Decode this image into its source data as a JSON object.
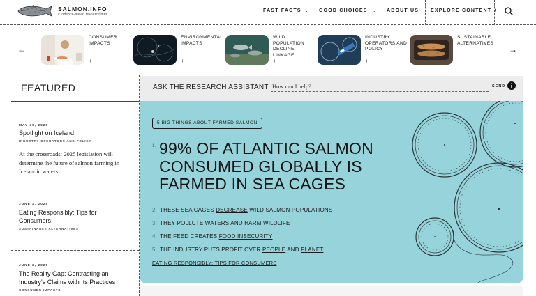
{
  "header": {
    "site_name": "SALMON.INFO",
    "tagline": "Evidence-based resource hub",
    "nav": [
      {
        "label": "FAST FACTS"
      },
      {
        "label": "GOOD CHOICES"
      },
      {
        "label": "ABOUT US"
      },
      {
        "label": "EXPLORE CONTENT +"
      }
    ],
    "icons": {
      "logo": "salmon-fish-logo",
      "search": "search-icon"
    }
  },
  "topics": {
    "prev_arrow": "←",
    "next_arrow": "→",
    "plus": "+",
    "items": [
      {
        "label": "CONSUMER IMPACTS"
      },
      {
        "label": "ENVIRONMENTAL IMPACTS"
      },
      {
        "label": "WILD POPULATION DECLINE LINKAGE"
      },
      {
        "label": "INDUSTRY OPERATORS AND POLICY"
      },
      {
        "label": "SUSTAINABLE ALTERNATIVES"
      }
    ]
  },
  "featured": {
    "title": "FEATURED",
    "items": [
      {
        "date": "MAY 30, 2025",
        "title": "Spotlight on Iceland",
        "category": "INDUSTRY OPERATORS AND POLICY",
        "excerpt": "At the crossroads: 2025 legislation will determine the future of salmon farming in Icelandic waters"
      },
      {
        "date": "JUNE 2, 2025",
        "title": "Eating Responsibly: Tips for Consumers",
        "category": "SUSTAINABLE ALTERNATIVES"
      },
      {
        "date": "JUNE 2, 2025",
        "title": "The Reality Gap: Contrasting an Industry's Claims with Its Practices",
        "category": "CONSUMER IMPACTS"
      }
    ]
  },
  "assistant": {
    "title": "ASK THE RESEARCH ASSISTANT",
    "placeholder": "How can I help?",
    "send_label": "SEND",
    "info_icon": "info-icon"
  },
  "hero": {
    "badge": "5 BIG THINGS ABOUT FARMED SALMON",
    "headline_number": "1.",
    "headline": "99% OF ATLANTIC SALMON CONSUMED GLOBALLY IS FARMED IN SEA CAGES",
    "facts": [
      {
        "n": "2.",
        "pre": "THESE SEA CAGES ",
        "link": "DECREASE",
        "post": " WILD SALMON POPULATIONS"
      },
      {
        "n": "3.",
        "pre": "THEY ",
        "link": "POLLUTE",
        "post": " WATERS AND HARM WILDLIFE"
      },
      {
        "n": "4.",
        "pre": "THE FEED CREATES ",
        "link": "FOOD INSECURITY",
        "post": ""
      },
      {
        "n": "5.",
        "pre": "THE INDUSTRY PUTS PROFIT OVER ",
        "link": "PEOPLE",
        "mid": " AND ",
        "link2": "PLANET",
        "post": ""
      }
    ],
    "cta": "EATING RESPONSIBLY: TIPS FOR CONSUMERS",
    "accent_color": "#97d3da"
  }
}
